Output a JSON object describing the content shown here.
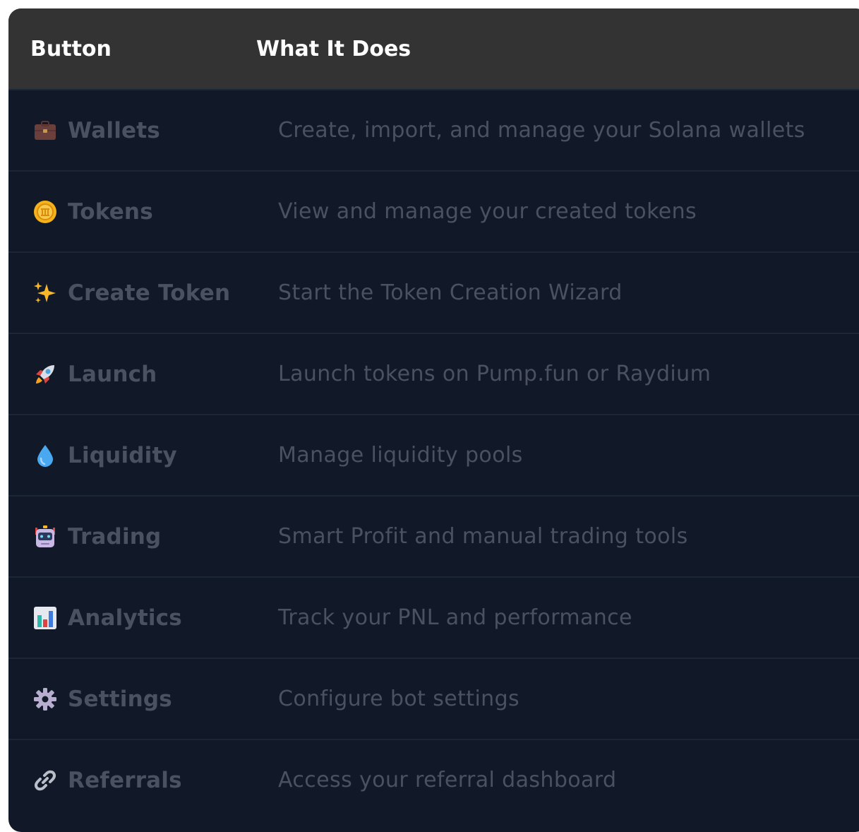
{
  "table": {
    "headers": {
      "button": "Button",
      "description": "What It Does"
    },
    "rows": [
      {
        "icon": "briefcase-icon",
        "label": "Wallets",
        "description": "Create, import, and manage your Solana wallets"
      },
      {
        "icon": "coin-icon",
        "label": "Tokens",
        "description": "View and manage your created tokens"
      },
      {
        "icon": "sparkles-icon",
        "label": "Create Token",
        "description": "Start the Token Creation Wizard"
      },
      {
        "icon": "rocket-icon",
        "label": "Launch",
        "description": "Launch tokens on Pump.fun or Raydium"
      },
      {
        "icon": "droplet-icon",
        "label": "Liquidity",
        "description": "Manage liquidity pools"
      },
      {
        "icon": "robot-icon",
        "label": "Trading",
        "description": "Smart Profit and manual trading tools"
      },
      {
        "icon": "bar-chart-icon",
        "label": "Analytics",
        "description": "Track your PNL and performance"
      },
      {
        "icon": "gear-icon",
        "label": "Settings",
        "description": "Configure bot settings"
      },
      {
        "icon": "link-icon",
        "label": "Referrals",
        "description": "Access your referral dashboard"
      }
    ]
  },
  "colors": {
    "header_bg": "#333333",
    "body_bg": "#111827",
    "row_divider": "#1b2637",
    "muted_text": "#4a5160",
    "header_text": "#ffffff"
  }
}
